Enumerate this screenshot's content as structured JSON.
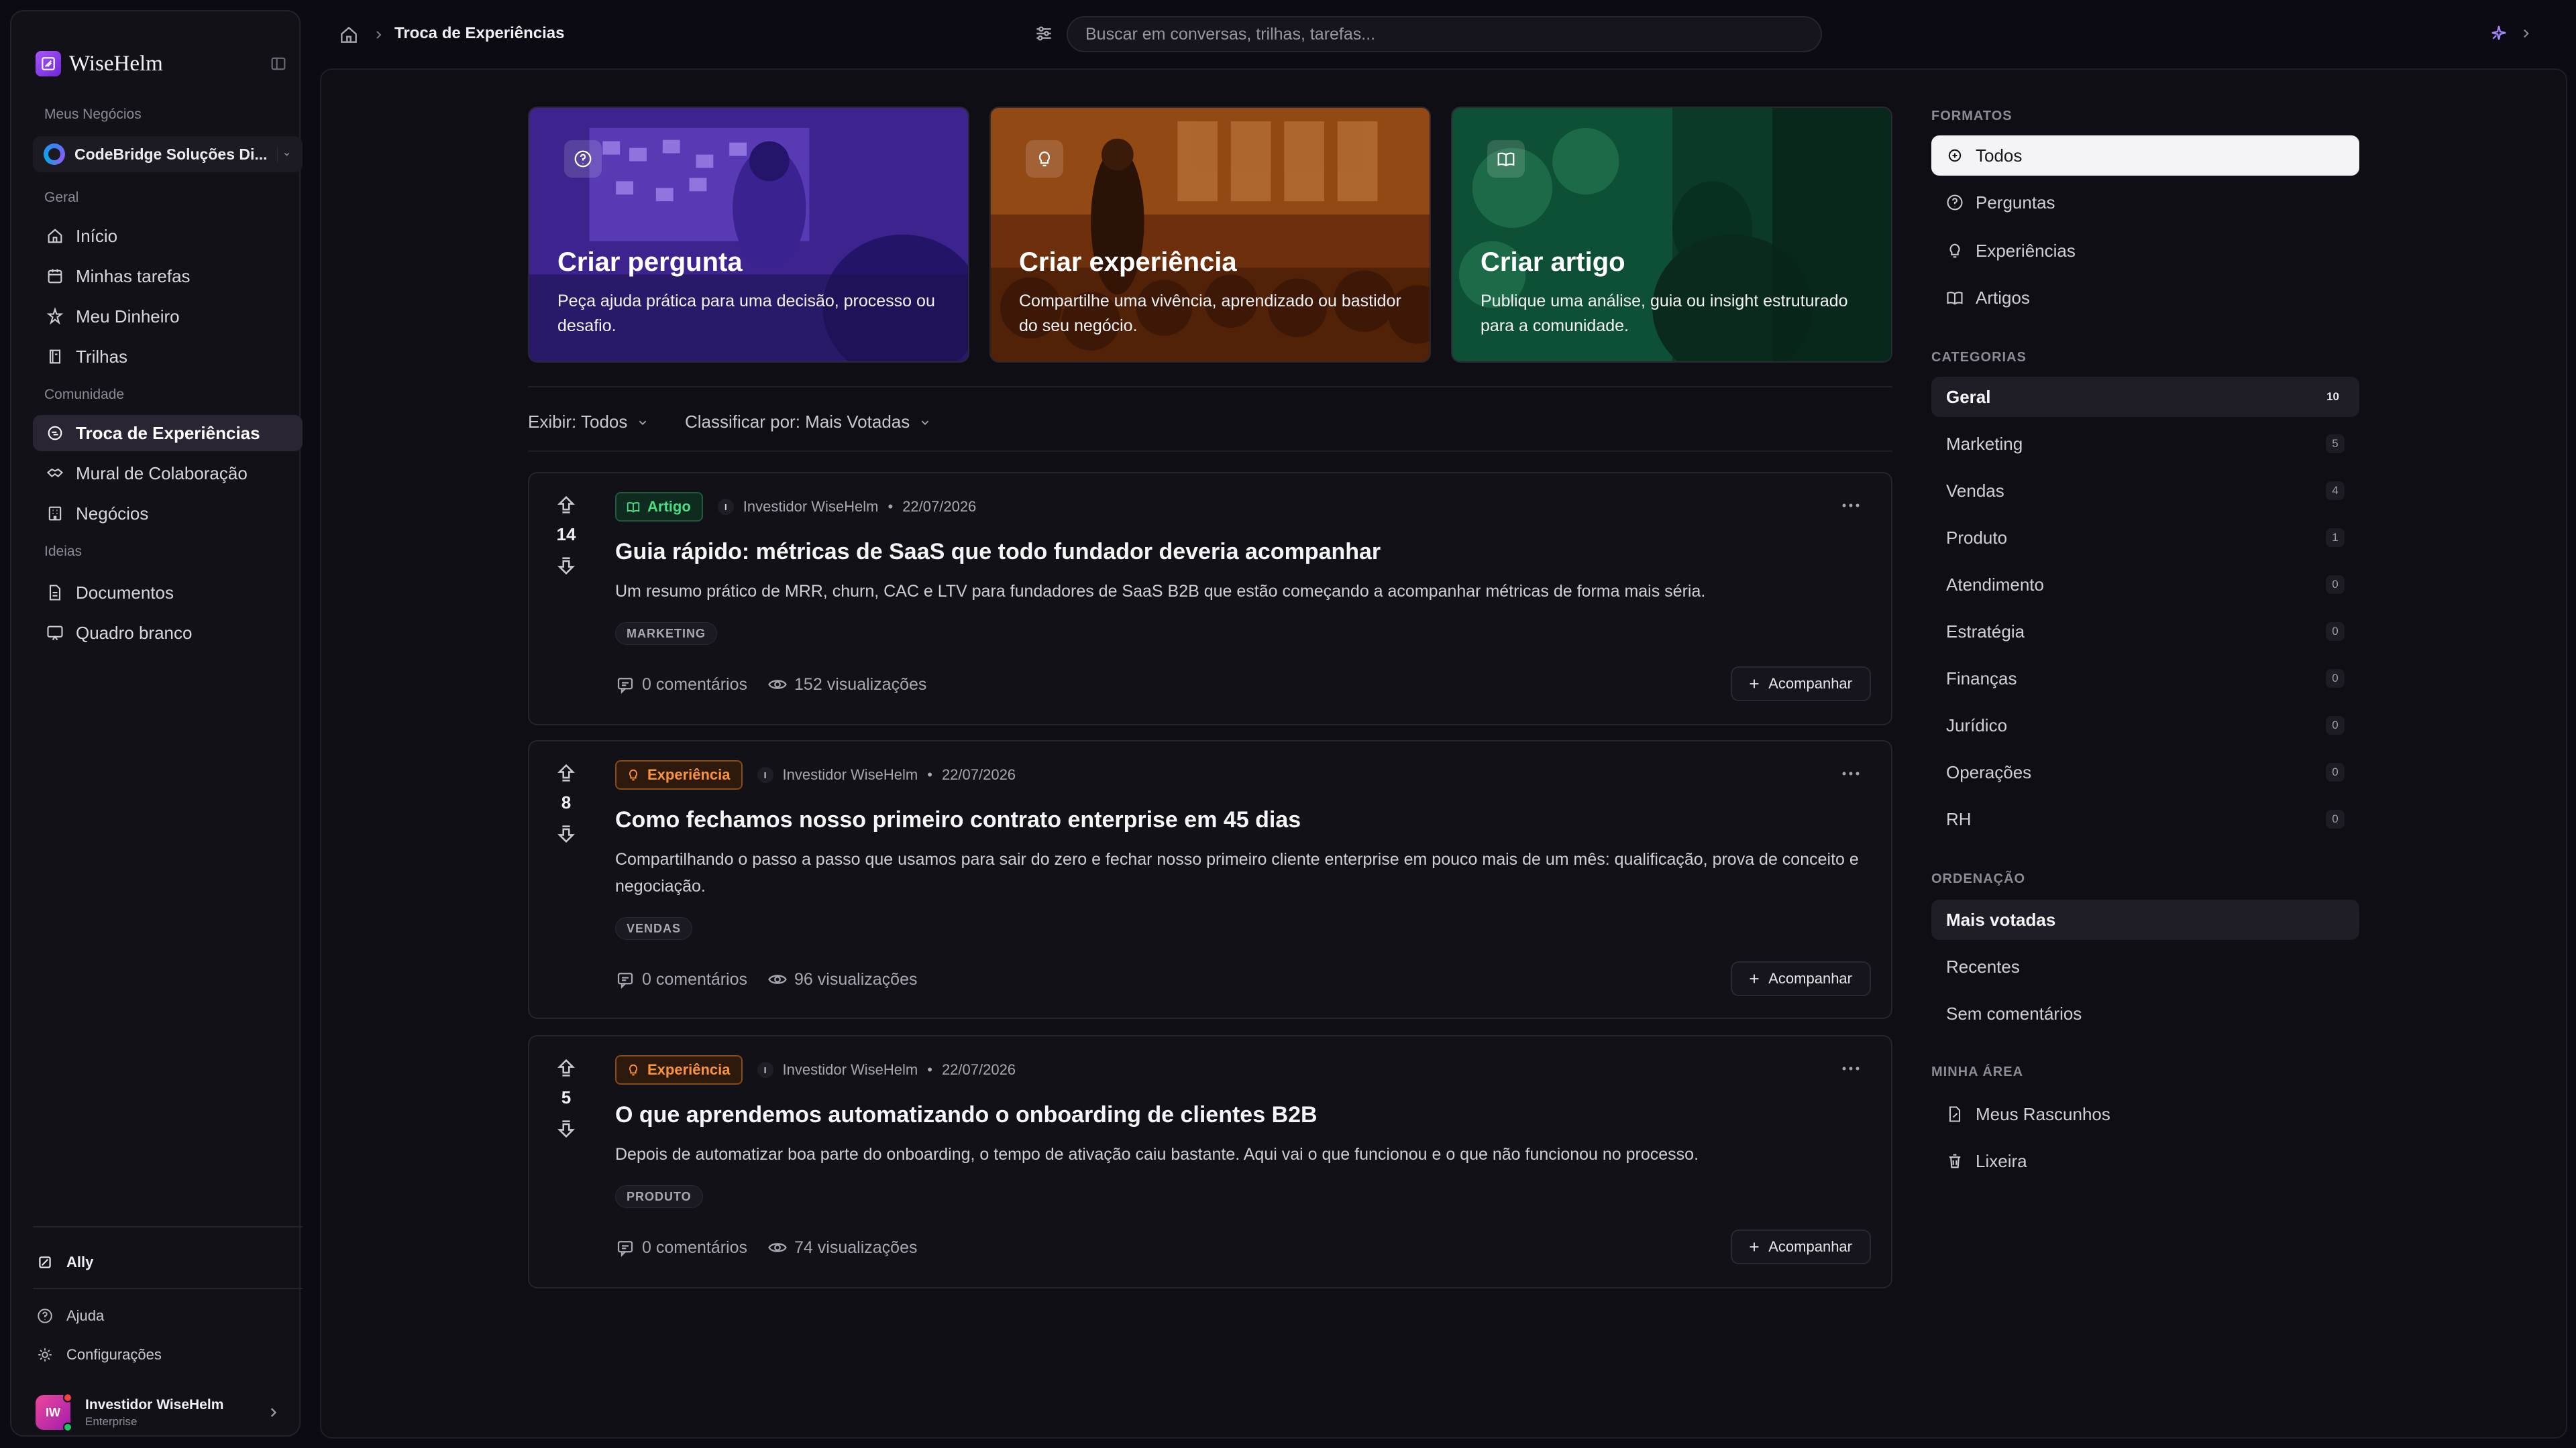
{
  "app": {
    "logo_text": "WiseHelm"
  },
  "sidebar": {
    "section_businesses": "Meus Negócios",
    "business_name": "CodeBridge Soluções Di...",
    "section_general": "Geral",
    "general_items": [
      {
        "label": "Início",
        "icon": "home-icon"
      },
      {
        "label": "Minhas tarefas",
        "icon": "calendar-icon"
      },
      {
        "label": "Meu Dinheiro",
        "icon": "coins-icon"
      },
      {
        "label": "Trilhas",
        "icon": "book-icon"
      }
    ],
    "section_community": "Comunidade",
    "community_items": [
      {
        "label": "Troca de Experiências",
        "icon": "chat-exchange-icon",
        "active": true
      },
      {
        "label": "Mural de Colaboração",
        "icon": "handshake-icon"
      },
      {
        "label": "Negócios",
        "icon": "building-icon"
      }
    ],
    "section_ideas": "Ideias",
    "idea_items": [
      {
        "label": "Documentos",
        "icon": "document-icon"
      },
      {
        "label": "Quadro branco",
        "icon": "whiteboard-icon"
      }
    ],
    "ally_label": "Ally",
    "help_label": "Ajuda",
    "settings_label": "Configurações",
    "user": {
      "initials": "IW",
      "name": "Investidor WiseHelm",
      "plan": "Enterprise"
    }
  },
  "topbar": {
    "breadcrumb_title": "Troca de Experiências",
    "search_placeholder": "Buscar em conversas, trilhas, tarefas..."
  },
  "heroes": [
    {
      "title": "Criar pergunta",
      "desc": "Peça ajuda prática para uma decisão, processo ou desafio.",
      "icon": "question-circle-icon",
      "tint": "#4b2ca8"
    },
    {
      "title": "Criar experiência",
      "desc": "Compartilhe uma vivência, aprendizado ou bastidor do seu negócio.",
      "icon": "lightbulb-icon",
      "tint": "#8a3d10"
    },
    {
      "title": "Criar artigo",
      "desc": "Publique uma análise, guia ou insight estruturado para a comunidade.",
      "icon": "open-book-icon",
      "tint": "#0f5a3c"
    }
  ],
  "filters": {
    "show_label": "Exibir: Todos",
    "sort_label": "Classificar por: Mais Votadas"
  },
  "posts": [
    {
      "votes": "14",
      "type": "Artigo",
      "type_key": "artigo",
      "author_initial": "I",
      "author": "Investidor WiseHelm",
      "date": "22/07/2026",
      "title": "Guia rápido: métricas de SaaS que todo fundador deveria acompanhar",
      "desc": "Um resumo prático de MRR, churn, CAC e LTV para fundadores de SaaS B2B que estão começando a acompanhar métricas de forma mais séria.",
      "tag": "MARKETING",
      "comments": "0 comentários",
      "views": "152 visualizações",
      "follow": "Acompanhar"
    },
    {
      "votes": "8",
      "type": "Experiência",
      "type_key": "exp",
      "author_initial": "I",
      "author": "Investidor WiseHelm",
      "date": "22/07/2026",
      "title": "Como fechamos nosso primeiro contrato enterprise em 45 dias",
      "desc": "Compartilhando o passo a passo que usamos para sair do zero e fechar nosso primeiro cliente enterprise em pouco mais de um mês: qualificação, prova de conceito e negociação.",
      "tag": "VENDAS",
      "comments": "0 comentários",
      "views": "96 visualizações",
      "follow": "Acompanhar"
    },
    {
      "votes": "5",
      "type": "Experiência",
      "type_key": "exp",
      "author_initial": "I",
      "author": "Investidor WiseHelm",
      "date": "22/07/2026",
      "title": "O que aprendemos automatizando o onboarding de clientes B2B",
      "desc": "Depois de automatizar boa parte do onboarding, o tempo de ativação caiu bastante. Aqui vai o que funcionou e o que não funcionou no processo.",
      "tag": "PRODUTO",
      "comments": "0 comentários",
      "views": "74 visualizações",
      "follow": "Acompanhar"
    }
  ],
  "right_panel": {
    "formats_title": "FORMATOS",
    "formats": [
      {
        "label": "Todos",
        "icon": "all-formats-icon",
        "selected": true
      },
      {
        "label": "Perguntas",
        "icon": "question-circle-icon"
      },
      {
        "label": "Experiências",
        "icon": "lightbulb-icon"
      },
      {
        "label": "Artigos",
        "icon": "open-book-icon"
      }
    ],
    "categories_title": "CATEGORIAS",
    "categories": [
      {
        "label": "Geral",
        "count": "10",
        "selected": true
      },
      {
        "label": "Marketing",
        "count": "5"
      },
      {
        "label": "Vendas",
        "count": "4"
      },
      {
        "label": "Produto",
        "count": "1"
      },
      {
        "label": "Atendimento",
        "count": "0"
      },
      {
        "label": "Estratégia",
        "count": "0"
      },
      {
        "label": "Finanças",
        "count": "0"
      },
      {
        "label": "Jurídico",
        "count": "0"
      },
      {
        "label": "Operações",
        "count": "0"
      },
      {
        "label": "RH",
        "count": "0"
      }
    ],
    "sort_title": "ORDENAÇÃO",
    "sort_options": [
      {
        "label": "Mais votadas",
        "selected": true
      },
      {
        "label": "Recentes"
      },
      {
        "label": "Sem comentários"
      }
    ],
    "my_area_title": "MINHA ÁREA",
    "my_area": [
      {
        "label": "Meus Rascunhos",
        "icon": "draft-icon"
      },
      {
        "label": "Lixeira",
        "icon": "trash-icon"
      }
    ]
  }
}
